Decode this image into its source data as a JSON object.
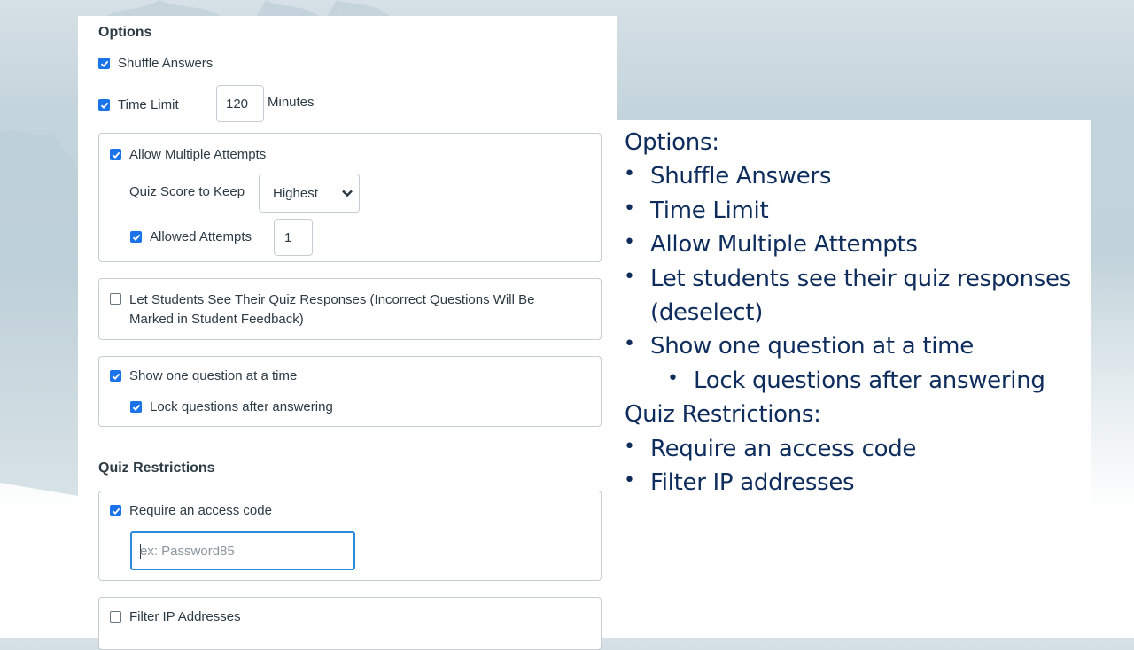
{
  "options": {
    "title": "Options",
    "shuffle_answers": {
      "label": "Shuffle Answers",
      "checked": true
    },
    "time_limit": {
      "label": "Time Limit",
      "checked": true,
      "value": "120",
      "unit": "Minutes"
    },
    "multiple_attempts": {
      "label": "Allow Multiple Attempts",
      "checked": true,
      "score_to_keep_label": "Quiz Score to Keep",
      "score_to_keep_value": "Highest",
      "allowed_attempts": {
        "label": "Allowed Attempts",
        "checked": true,
        "value": "1"
      }
    },
    "see_responses": {
      "label_line1": "Let Students See Their Quiz Responses (Incorrect Questions Will Be",
      "label_line2": "Marked in Student Feedback)",
      "checked": false
    },
    "one_question": {
      "label": "Show one question at a time",
      "checked": true,
      "lock": {
        "label": "Lock questions after answering",
        "checked": true
      }
    }
  },
  "restrictions": {
    "title": "Quiz Restrictions",
    "access_code": {
      "label": "Require an access code",
      "checked": true,
      "placeholder": "ex: Password85",
      "value": ""
    },
    "filter_ip": {
      "label": "Filter IP Addresses",
      "checked": false
    }
  },
  "notes": {
    "heading_options": "Options:",
    "options_items": [
      "Shuffle Answers",
      "Time Limit",
      "Allow Multiple Attempts",
      "Let students see their quiz responses",
      "(deselect)",
      "Show one question at a time",
      "Lock questions after answering"
    ],
    "heading_restrictions": "Quiz Restrictions:",
    "restriction_items": [
      "Require an access code",
      "Filter IP addresses"
    ],
    "bullet": "•"
  },
  "colors": {
    "checkbox_blue": "#1a73e8",
    "focus_blue": "#2b8ad9",
    "notes_text": "#0f2d5c",
    "ui_text": "#2d3b45"
  }
}
